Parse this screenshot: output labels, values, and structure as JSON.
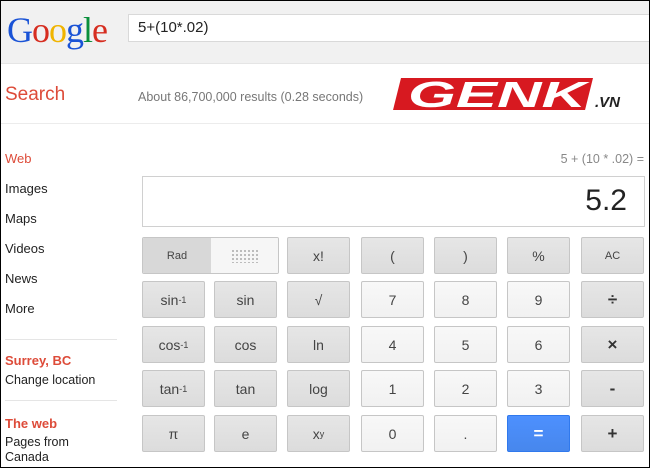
{
  "logo": {
    "letters": [
      "G",
      "o",
      "o",
      "g",
      "l",
      "e"
    ],
    "colors": [
      "#1a53d6",
      "#d62d20",
      "#f0b400",
      "#1a53d6",
      "#0a8f3c",
      "#d62d20"
    ]
  },
  "search": {
    "query": "5+(10*.02)"
  },
  "page": {
    "title": "Search",
    "stats": "About 86,700,000 results (0.28 seconds)"
  },
  "watermark": {
    "main": "GENK",
    "suffix": ".VN"
  },
  "sidebar": {
    "items": [
      {
        "label": "Web",
        "active": true
      },
      {
        "label": "Images"
      },
      {
        "label": "Maps"
      },
      {
        "label": "Videos"
      },
      {
        "label": "News"
      },
      {
        "label": "More"
      }
    ],
    "location": {
      "title": "Surrey, BC",
      "change": "Change location"
    },
    "web": {
      "title": "The web",
      "pages_from": "Pages from Canada"
    }
  },
  "calculator": {
    "expression": "5 + (10 * .02) =",
    "result": "5.2",
    "rad_label": "Rad",
    "buttons": {
      "fact": "x!",
      "lparen": "(",
      "rparen": ")",
      "percent": "%",
      "ac": "AC",
      "asin": "sin",
      "sin": "sin",
      "sqrt": "√",
      "n7": "7",
      "n8": "8",
      "n9": "9",
      "div": "÷",
      "acos": "cos",
      "cos": "cos",
      "ln": "ln",
      "n4": "4",
      "n5": "5",
      "n6": "6",
      "mul": "×",
      "atan": "tan",
      "tan": "tan",
      "log": "log",
      "n1": "1",
      "n2": "2",
      "n3": "3",
      "sub": "-",
      "pi": "π",
      "e": "e",
      "pow": "x",
      "n0": "0",
      "dot": ".",
      "eq": "=",
      "add": "+",
      "inverse_sup": "-1",
      "pow_sup": "y"
    }
  }
}
